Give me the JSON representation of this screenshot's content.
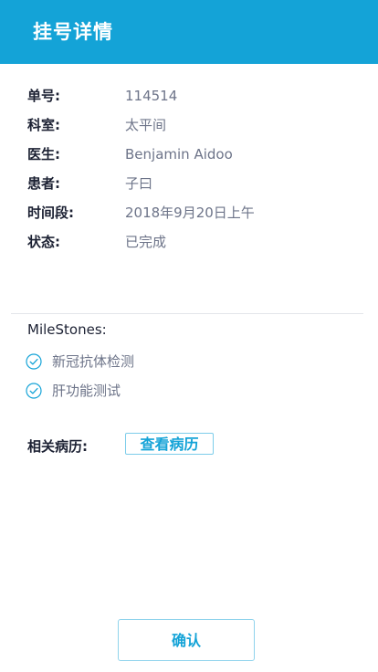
{
  "header": {
    "title": "挂号详情",
    "background_color": "#14a3d7"
  },
  "details": {
    "number": {
      "label": "单号:",
      "value": "114514"
    },
    "department": {
      "label": "科室:",
      "value": "太平间"
    },
    "doctor": {
      "label": "医生:",
      "value": "Benjamin Aidoo"
    },
    "patient": {
      "label": "患者:",
      "value": "子曰"
    },
    "time_slot": {
      "label": "时间段:",
      "value": "2018年9月20日上午"
    },
    "status": {
      "label": "状态:",
      "value": "已完成"
    }
  },
  "milestones": {
    "title": "MileStones:",
    "items": [
      {
        "label": "新冠抗体检测",
        "icon": "check-circle-icon"
      },
      {
        "label": "肝功能测试",
        "icon": "check-circle-icon"
      }
    ]
  },
  "records": {
    "label": "相关病历:",
    "button_label": "查看病历"
  },
  "footer": {
    "confirm_label": "确认"
  },
  "colors": {
    "accent": "#14a3d7",
    "label_text": "#1c2133",
    "value_text": "#6d7489"
  }
}
